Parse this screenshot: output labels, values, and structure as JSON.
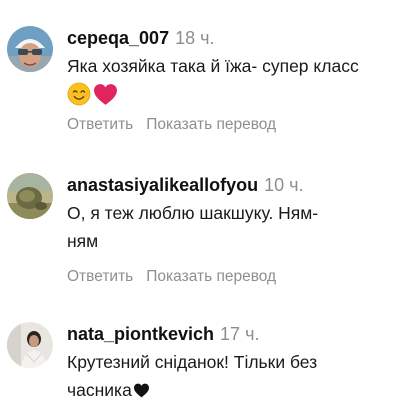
{
  "comments": [
    {
      "username": "сереqa_007",
      "time": "18 ч.",
      "text_lines": [
        "Яка хозяйка така й їжа- супер класс"
      ],
      "emojis": [
        "smiling-face",
        "red-heart"
      ],
      "reply_label": "Ответить",
      "translate_label": "Показать перевод"
    },
    {
      "username": "anastasiyalikeallofyou",
      "time": "10 ч.",
      "text_lines": [
        "О, я теж люблю шакшуку. Ням-",
        "ням"
      ],
      "reply_label": "Ответить",
      "translate_label": "Показать перевод"
    },
    {
      "username": "nata_piontkevich",
      "time": "17 ч.",
      "text_lines": [
        "Крутезний сніданок! Тільки без",
        "часника"
      ],
      "emojis": [
        "black-heart"
      ]
    }
  ],
  "colors": {
    "username": "#111111",
    "secondary_text": "#8e8e8e",
    "heart_red": "#e0245e"
  }
}
